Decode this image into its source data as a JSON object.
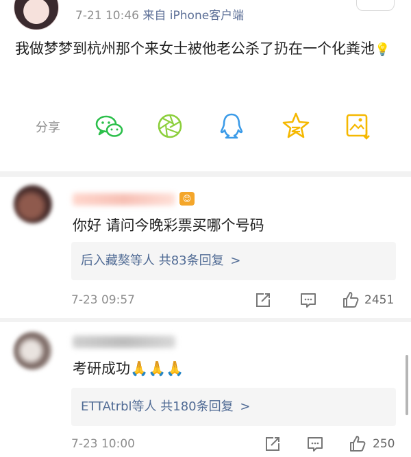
{
  "post": {
    "time": "7-21 10:46",
    "source": "来自 iPhone客户端",
    "text": "我做梦梦到杭州那个来女士被他老公杀了扔在一个化粪池",
    "emoji": "💡"
  },
  "share": {
    "label": "分享",
    "icons": [
      "wechat-icon",
      "moments-icon",
      "qq-icon",
      "qzone-icon",
      "save-image-icon"
    ]
  },
  "comments": [
    {
      "badge": "😊",
      "text": "你好 请问今晚彩票买哪个号码",
      "replies_names": "后入藏獒等人",
      "replies_count": "共83条回复",
      "replies_arrow": ">",
      "time": "7-23 09:57",
      "likes": "2451"
    },
    {
      "text": "考研成功🙏🙏🙏",
      "replies_names": "ETTAtrbl等人",
      "replies_count": "共180条回复",
      "replies_arrow": ">",
      "time": "7-23 10:00",
      "likes": "250"
    }
  ],
  "colors": {
    "meta_gray": "#8e8e8e",
    "link_blue": "#4f6a94",
    "icon_green": "#2bbf4a",
    "icon_blue": "#3b9be8",
    "icon_gold": "#f5b800",
    "reply_bg": "#f5f5f5",
    "divider": "#f2f2f2"
  }
}
